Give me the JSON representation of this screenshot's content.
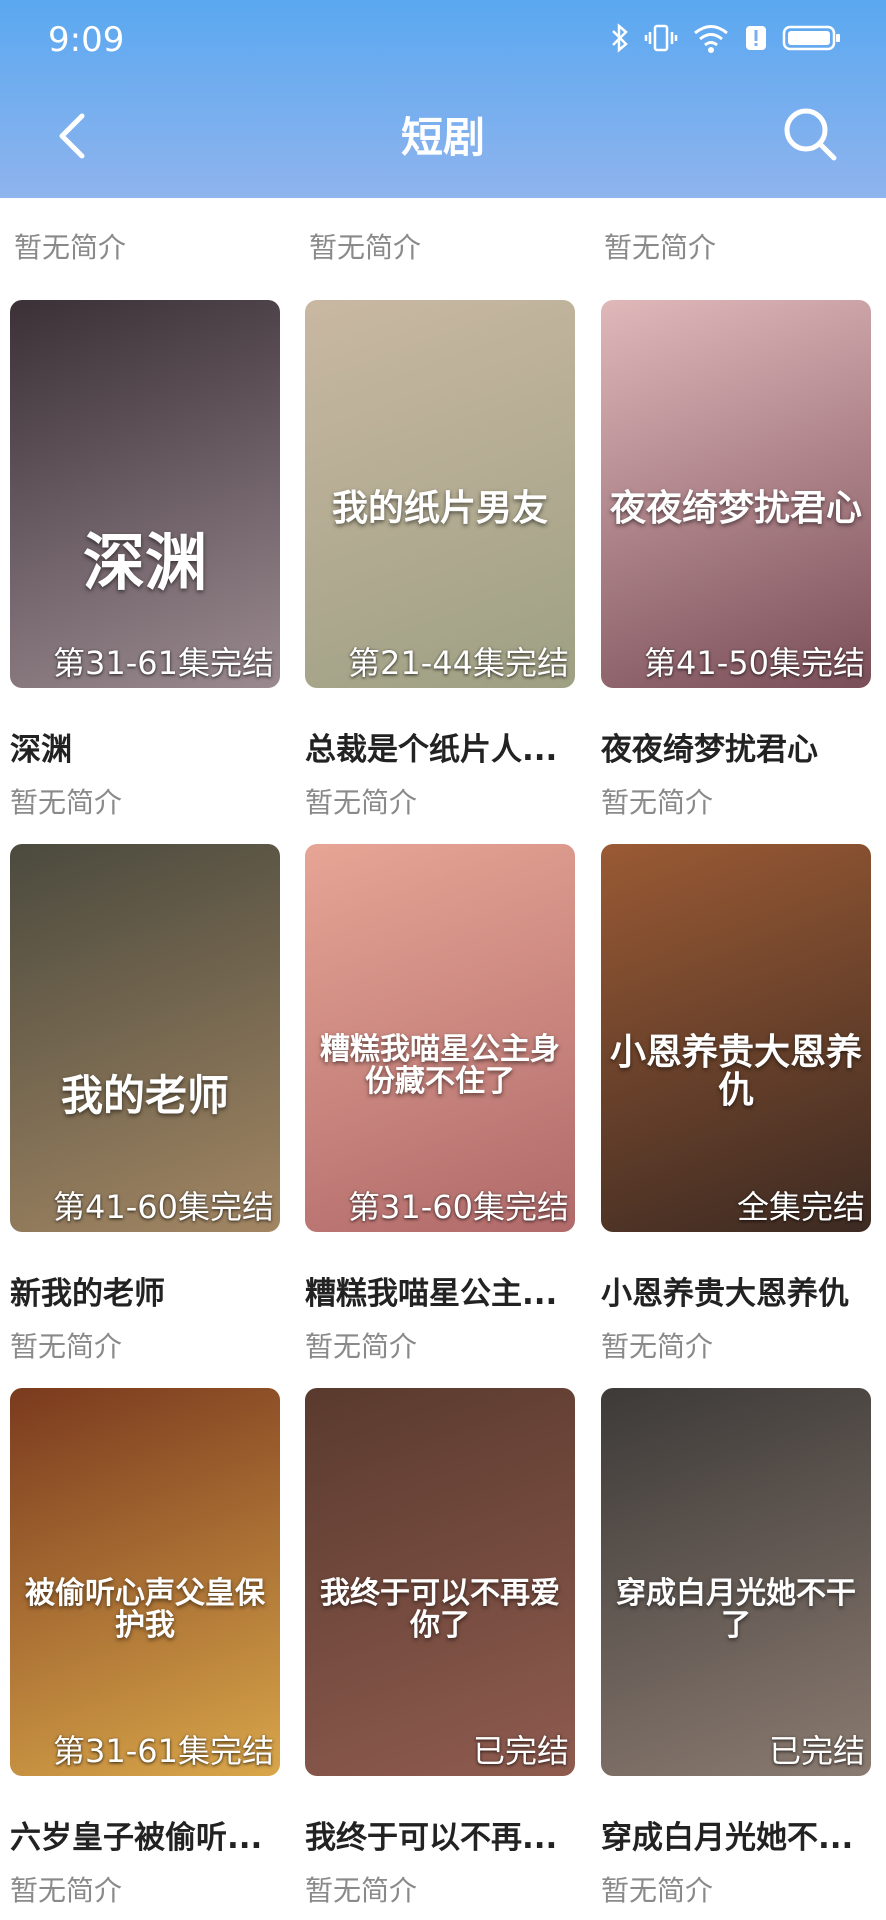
{
  "status": {
    "time": "9:09"
  },
  "nav": {
    "title": "短剧"
  },
  "top_row": [
    "暂无简介",
    "暂无简介",
    "暂无简介"
  ],
  "cards": [
    {
      "title": "深渊",
      "desc": "暂无简介",
      "badge": "第31-61集完结",
      "poster_text": "深渊",
      "colors": [
        "#3a3036",
        "#9a8a90"
      ]
    },
    {
      "title": "总裁是个纸片人...",
      "desc": "暂无简介",
      "badge": "第21-44集完结",
      "poster_text": "我的纸片男友",
      "colors": [
        "#c9b8a2",
        "#9ea083"
      ]
    },
    {
      "title": "夜夜绮梦扰君心",
      "desc": "暂无简介",
      "badge": "第41-50集完结",
      "poster_text": "夜夜绮梦扰君心",
      "colors": [
        "#e0b8ba",
        "#7a4e58"
      ]
    },
    {
      "title": "新我的老师",
      "desc": "暂无简介",
      "badge": "第41-60集完结",
      "poster_text": "我的老师",
      "colors": [
        "#4b4a3e",
        "#a28663"
      ]
    },
    {
      "title": "糟糕我喵星公主...",
      "desc": "暂无简介",
      "badge": "第31-60集完结",
      "poster_text": "糟糕我喵星公主身份藏不住了",
      "colors": [
        "#e6a595",
        "#b06a6a"
      ]
    },
    {
      "title": "小恩养贵大恩养仇",
      "desc": "暂无简介",
      "badge": "全集完结",
      "poster_text": "小恩养贵大恩养仇",
      "colors": [
        "#9a5a34",
        "#3c2a22"
      ]
    },
    {
      "title": "六岁皇子被偷听...",
      "desc": "暂无简介",
      "badge": "第31-61集完结",
      "poster_text": "被偷听心声父皇保护我",
      "colors": [
        "#7a3a1e",
        "#d9a64a"
      ]
    },
    {
      "title": "我终于可以不再...",
      "desc": "暂无简介",
      "badge": "已完结",
      "poster_text": "我终于可以不再爱你了",
      "colors": [
        "#5a3a2e",
        "#8f5b4f"
      ]
    },
    {
      "title": "穿成白月光她不...",
      "desc": "暂无简介",
      "badge": "已完结",
      "poster_text": "穿成白月光她不干了",
      "colors": [
        "#3d3a38",
        "#8a7a70"
      ]
    }
  ]
}
